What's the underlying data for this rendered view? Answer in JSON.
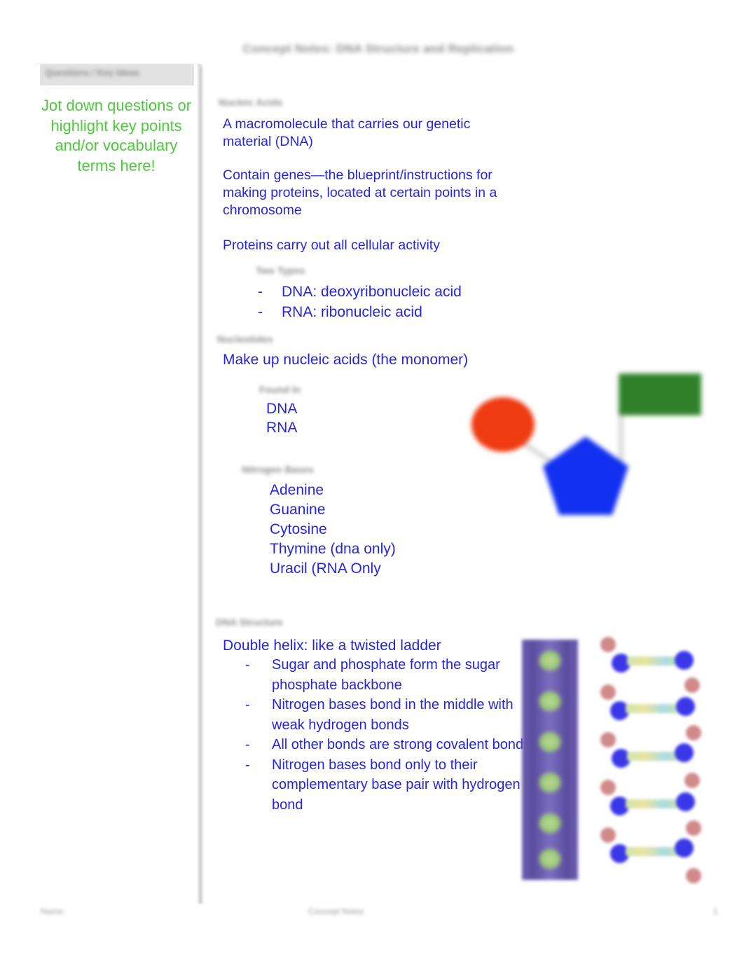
{
  "document": {
    "title": "Concept Notes: DNA Structure and Replication"
  },
  "sidebar": {
    "header_label": "Questions / Key Ideas",
    "note": "Jot down questions or highlight key points and/or vocabulary terms here!",
    "note_color": "#4ec83c"
  },
  "main": {
    "body_color": "#2525e0",
    "heading_color": "#909090",
    "sections": [
      {
        "heading": "Nucleic Acids",
        "paragraphs": [
          "A macromolecule that carries our genetic material (DNA)",
          "Contain genes—the blueprint/instructions for making proteins, located at certain points in a chromosome",
          "Proteins carry out all cellular activity"
        ],
        "subheading": "Two Types",
        "items": [
          "DNA: deoxyribonucleic acid",
          "RNA: ribonucleic acid"
        ]
      },
      {
        "heading": "Nucleotides",
        "lead": "Make up nucleic acids (the monomer)",
        "subheading": "Found In",
        "found_in": [
          "DNA",
          "RNA"
        ],
        "bases_heading": "Nitrogen Bases",
        "bases": [
          "Adenine",
          "Guanine",
          "Cytosine",
          "Thymine (dna only)",
          "Uracil (RNA Only"
        ]
      },
      {
        "heading": "DNA Structure",
        "lead": "Double helix: like a twisted ladder",
        "items": [
          "Sugar and phosphate form the sugar phosphate backbone",
          "Nitrogen bases bond in the middle with weak hydrogen bonds",
          "All other bonds are strong covalent bonds",
          "Nitrogen bases bond only to their complementary base pair with hydrogen bond"
        ]
      }
    ]
  },
  "figures": {
    "nucleotide": {
      "phosphate_color": "#ee3b12",
      "sugar_color": "#1130f0",
      "base_color": "#2f7f2b"
    },
    "dna_helix_label": "dna-double-helix-render",
    "dna_model_label": "dna-ball-and-stick-model"
  },
  "footer": {
    "left": "Name:",
    "center": "Concept Notes",
    "right": "1"
  }
}
